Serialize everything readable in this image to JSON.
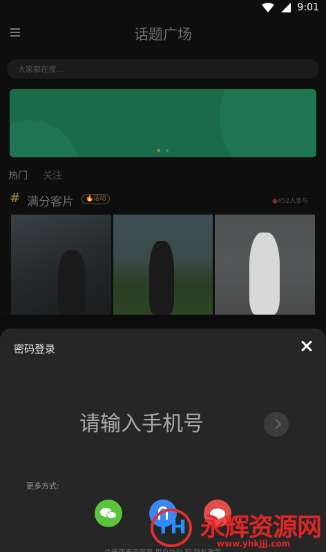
{
  "status_bar": {
    "time": "9:01",
    "icons": [
      "wifi-icon",
      "signal-icon"
    ]
  },
  "header": {
    "title": "话题广场",
    "menu_icon": "menu-icon"
  },
  "search": {
    "placeholder": "大家都在搜..."
  },
  "banner": {
    "color": "#1a6b4a",
    "pages": 2,
    "active_page": 1
  },
  "tabs": [
    {
      "label": "热门",
      "active": true
    },
    {
      "label": "关注",
      "active": false
    }
  ],
  "topic": {
    "hash": "#",
    "name": "满分客片",
    "badge": "活动",
    "participants": "452人参与",
    "photo_count": 3
  },
  "login_sheet": {
    "title": "密码登录",
    "phone_placeholder": "请输入手机号",
    "more_label": "更多方式:",
    "social": [
      {
        "name": "wechat",
        "color": "#5ac43c"
      },
      {
        "name": "alipay",
        "color": "#3e86f0"
      },
      {
        "name": "weibo",
        "color": "#e0504a"
      }
    ],
    "agreement": "注册即表示同意 用户协议 和 隐私政策"
  },
  "watermark": {
    "logo": "YH",
    "text": "永辉资源网",
    "url": "www.yhkjjj.com"
  },
  "colors": {
    "background": "#0e0e0e",
    "sheet": "#262626",
    "accent_gold": "#8d7430"
  }
}
